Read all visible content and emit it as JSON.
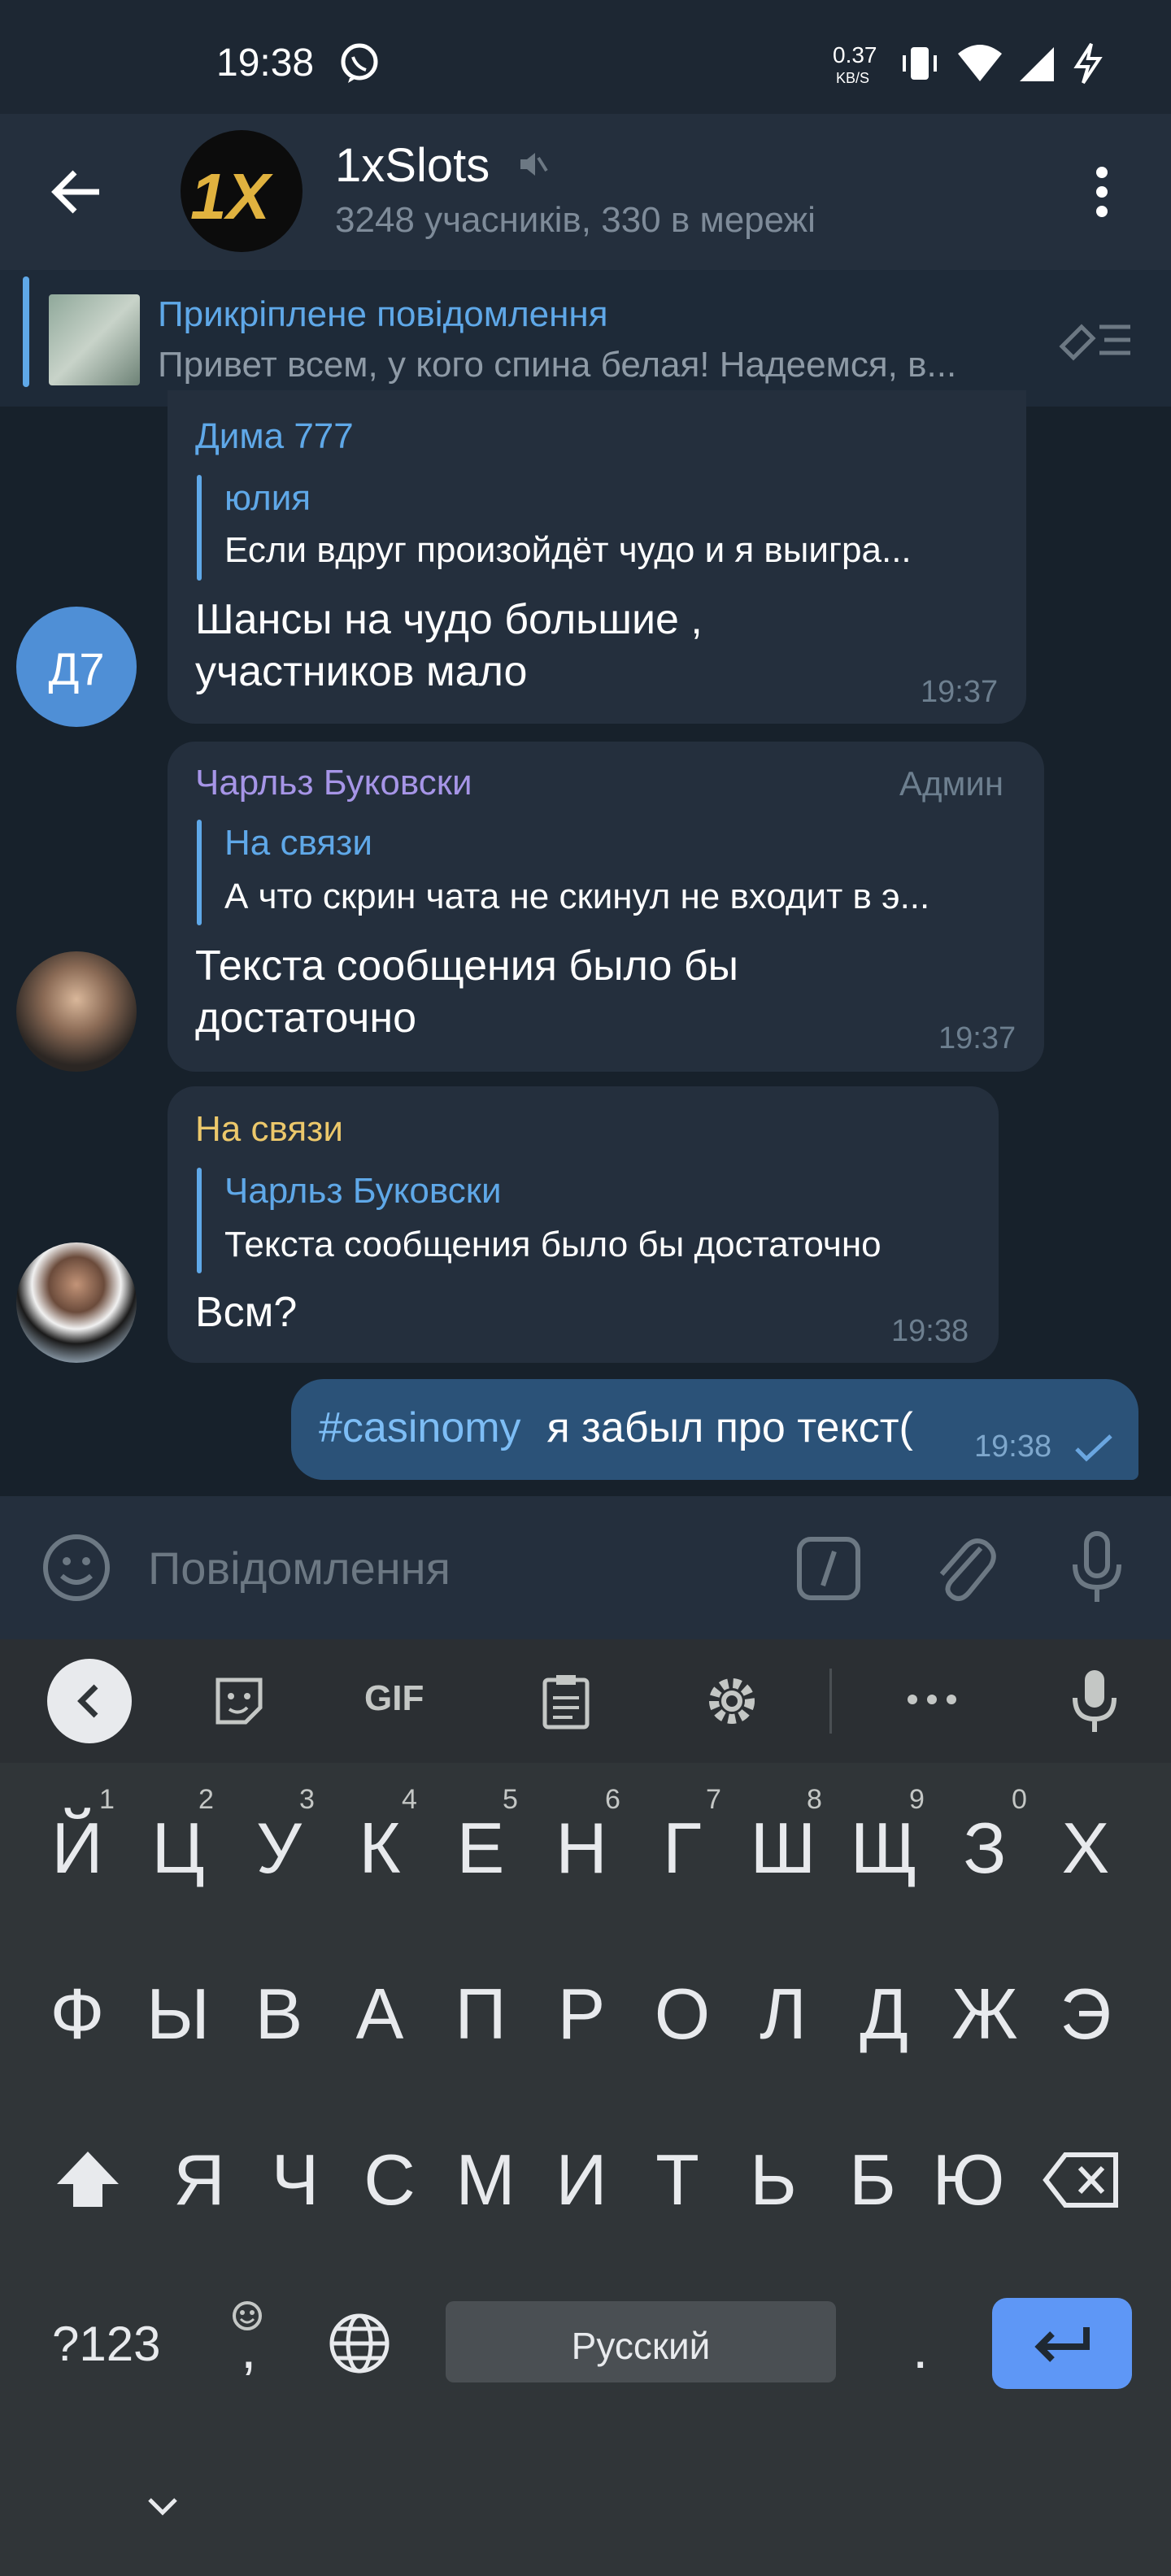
{
  "status_bar": {
    "time": "19:38",
    "net_speed": "0.37",
    "net_unit": "KB/S"
  },
  "header": {
    "title": "1xSlots",
    "subtitle": "3248 учасників, 330 в мережі",
    "logo_text": "1X"
  },
  "pinned": {
    "title": "Прикріплене повідомлення",
    "text": "Привет всем, у кого спина белая! Надеемся, в..."
  },
  "messages": [
    {
      "sender": "Дима 777",
      "avatar_initials": "Д7",
      "reply_to_name": "юлия",
      "reply_to_text": "Если вдруг произойдёт чудо и я выигра...",
      "line1": "Шансы на чудо большие ,",
      "line2": "участников мало",
      "time": "19:37"
    },
    {
      "sender": "Чарльз Буковски",
      "badge": "Админ",
      "reply_to_name": "На связи",
      "reply_to_text": "А что скрин чата не скинул не входит в э...",
      "line1": "Текста сообщения было бы",
      "line2": "достаточно",
      "time": "19:37"
    },
    {
      "sender": "На связи",
      "reply_to_name": "Чарльз Буковски",
      "reply_to_text": "Текста сообщения было бы достаточно",
      "line1": "Всм?",
      "time": "19:38"
    },
    {
      "hashtag": "#casinomy",
      "text": " я забыл про текст(",
      "time": "19:38"
    }
  ],
  "input": {
    "placeholder": "Повідомлення"
  },
  "keyboard_toolbar": {
    "gif_label": "GIF"
  },
  "keyboard": {
    "row1": [
      "Й",
      "Ц",
      "У",
      "К",
      "Е",
      "Н",
      "Г",
      "Ш",
      "Щ",
      "З",
      "Х"
    ],
    "row1_hints": [
      "1",
      "2",
      "3",
      "4",
      "5",
      "6",
      "7",
      "8",
      "9",
      "0"
    ],
    "row2": [
      "Ф",
      "Ы",
      "В",
      "А",
      "П",
      "Р",
      "О",
      "Л",
      "Д",
      "Ж",
      "Э"
    ],
    "row3": [
      "Я",
      "Ч",
      "С",
      "М",
      "И",
      "Т",
      "Ь",
      "Б",
      "Ю"
    ],
    "symbols_label": "?123",
    "comma_label": ",",
    "space_label": "Русский",
    "period_label": "."
  },
  "colors": {
    "accent": "#5fa8e8",
    "admin_name": "#a695e7",
    "user_name_orange": "#ecc86b",
    "outgoing_bubble": "#2b5278",
    "enter_key": "#5e97f6"
  }
}
